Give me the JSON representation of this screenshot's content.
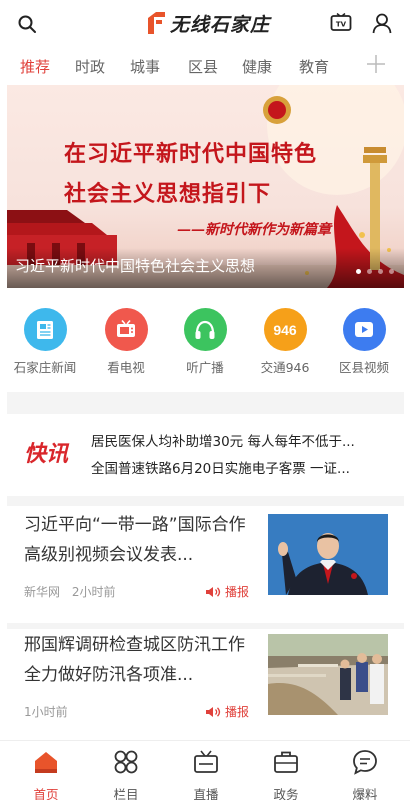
{
  "header": {
    "logo_text": "无线石家庄",
    "search_icon": "search-icon",
    "tv_icon": "tv-icon",
    "user_icon": "user-icon"
  },
  "tabs": [
    {
      "label": "推荐",
      "active": true
    },
    {
      "label": "时政"
    },
    {
      "label": "城事"
    },
    {
      "label": "区县"
    },
    {
      "label": "健康"
    },
    {
      "label": "教育"
    }
  ],
  "banner": {
    "line1": "在习近平新时代中国特色",
    "line2": "社会主义思想指引下",
    "slogan": "——新时代新作为新篇章",
    "caption": "习近平新时代中国特色社会主义思想",
    "slides": 4,
    "active_slide": 1
  },
  "quick_links": [
    {
      "label": "石家庄新闻",
      "icon": "newspaper-icon",
      "color": "#3eb8ec"
    },
    {
      "label": "看电视",
      "icon": "tv-icon",
      "color": "#f0584d"
    },
    {
      "label": "听广播",
      "icon": "headphones-icon",
      "color": "#3cc45f"
    },
    {
      "label": "交通946",
      "icon": "traffic-946-icon",
      "badge": "946",
      "color": "#f6a019"
    },
    {
      "label": "区县视频",
      "icon": "play-video-icon",
      "color": "#3d7cf0"
    }
  ],
  "flash": {
    "label": "快讯",
    "items": [
      "居民医保人均补助增30元 每人每年不低于...",
      "全国普速铁路6月20日实施电子客票 一证..."
    ]
  },
  "news": [
    {
      "title": "习近平向“一带一路”国际合作高级别视频会议发表...",
      "source": "新华网",
      "time": "2小时前",
      "play_label": "播报"
    },
    {
      "title": "邢国辉调研检查城区防汛工作 全力做好防汛各项准...",
      "source": "",
      "time": "1小时前",
      "play_label": "播报"
    }
  ],
  "bottom_nav": [
    {
      "label": "首页",
      "icon": "home-icon",
      "active": true
    },
    {
      "label": "栏目",
      "icon": "grid-icon"
    },
    {
      "label": "直播",
      "icon": "live-tv-icon"
    },
    {
      "label": "政务",
      "icon": "briefcase-icon"
    },
    {
      "label": "爆料",
      "icon": "chat-bubble-icon"
    }
  ],
  "colors": {
    "accent": "#e0413b",
    "banner_text": "#c4161c"
  }
}
